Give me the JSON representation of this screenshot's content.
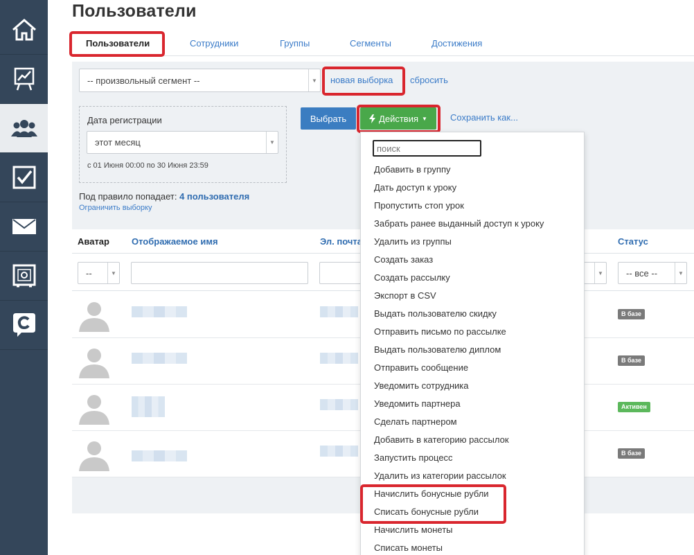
{
  "page": {
    "title": "Пользователи"
  },
  "tabs": [
    {
      "label": "Пользователи",
      "active": true
    },
    {
      "label": "Сотрудники"
    },
    {
      "label": "Группы"
    },
    {
      "label": "Сегменты"
    },
    {
      "label": "Достижения"
    }
  ],
  "sidebar": {
    "items": [
      {
        "icon": "home-icon"
      },
      {
        "icon": "chart-icon"
      },
      {
        "icon": "users-icon",
        "active": true
      },
      {
        "icon": "checkbox-icon"
      },
      {
        "icon": "mail-icon"
      },
      {
        "icon": "safe-icon"
      },
      {
        "icon": "chat-c-icon"
      }
    ]
  },
  "filters": {
    "segment_value": "-- произвольный сегмент --",
    "new_selection": "новая выборка",
    "reset": "сбросить",
    "date_label": "Дата регистрации",
    "date_value": "этот месяц",
    "date_range": "с 01 Июня 00:00 по 30 Июня 23:59",
    "select_button": "Выбрать",
    "actions_button": "Действия",
    "save_as": "Сохранить как...",
    "rule_prefix": "Под правило попадает:",
    "rule_count": "4 пользователя",
    "limit": "Ограничить выборку"
  },
  "table": {
    "headers": {
      "avatar": "Аватар",
      "name": "Отображаемое имя",
      "email": "Эл. почта",
      "status": "Статус"
    },
    "avatar_filter": "--",
    "status_filter": "-- все --",
    "rows": [
      {
        "status": "В базе",
        "status_color": "#7a7a7a"
      },
      {
        "status": "В базе",
        "status_color": "#7a7a7a"
      },
      {
        "status": "Активен",
        "status_color": "#5cb85c"
      },
      {
        "status": "В базе",
        "status_color": "#7a7a7a"
      }
    ]
  },
  "actions_menu": {
    "search_placeholder": "поиск",
    "items": [
      "Добавить в группу",
      "Дать доступ к уроку",
      "Пропустить стоп урок",
      "Забрать ранее выданный доступ к уроку",
      "Удалить из группы",
      "Создать заказ",
      "Создать рассылку",
      "Экспорт в CSV",
      "Выдать пользователю скидку",
      "Отправить письмо по рассылке",
      "Выдать пользователю диплом",
      "Отправить сообщение",
      "Уведомить сотрудника",
      "Уведомить партнера",
      "Сделать партнером",
      "Добавить в категорию рассылок",
      "Запустить процесс",
      "Удалить из категории рассылок",
      "Начислить бонусные рубли",
      "Списать бонусные рубли",
      "Начислить монеты",
      "Списать монеты"
    ]
  },
  "colors": {
    "sidebar": "#34465a",
    "link": "#3a7bc8",
    "highlight": "#d9262e",
    "primary_button": "#3b7dc1",
    "actions_button": "#49a84a"
  }
}
